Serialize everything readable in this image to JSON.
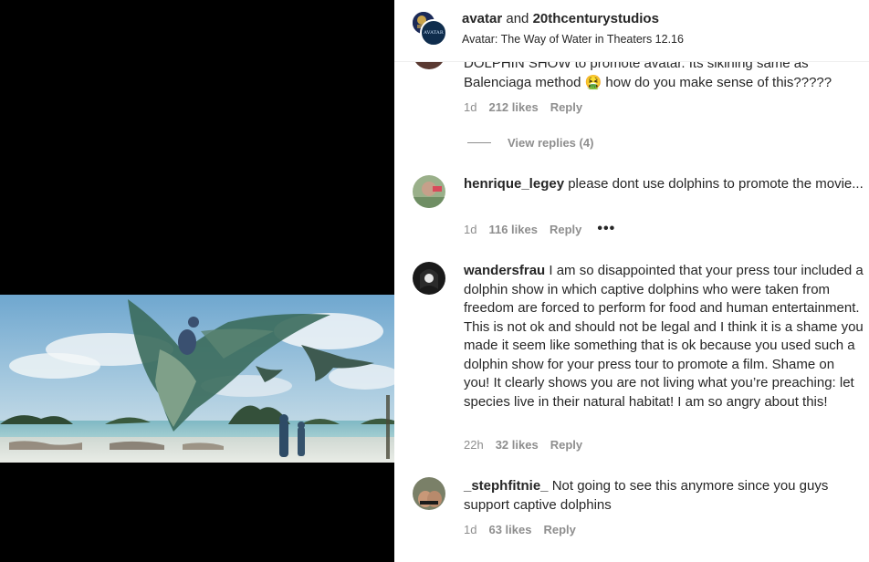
{
  "post": {
    "header": {
      "user1": "avatar",
      "joiner": " and ",
      "user2": "20thcenturystudios",
      "subtitle": "Avatar: The Way of Water in Theaters 12.16",
      "avatar_logo_text": "AVATAR"
    }
  },
  "comments": [
    {
      "partial": true,
      "text_line1": "DOLPHIN SHOW to promote avatar. Its sikining same as",
      "text_line2": "Balenciaga method 🤮  how do you make sense of this?????",
      "time": "1d",
      "likes": "212 likes",
      "reply": "Reply",
      "view_replies": "View replies (4)"
    },
    {
      "user": "henrique_legey",
      "text": "please dont use dolphins to promote the movie...",
      "time": "1d",
      "likes": "116 likes",
      "reply": "Reply",
      "more": "•••"
    },
    {
      "user": "wandersfrau",
      "text": "I am so disappointed that your press tour included a dolphin show in which captive dolphins who were taken from freedom are forced to perform for food and human entertainment. This is not ok and should not be legal and I think it is a shame you made it seem like something that is ok because you used such a dolphin show for your press tour to promote a film. Shame on you! It clearly shows you are not living what you’re preaching: let species live in their natural habitat! I am so angry about this!",
      "time": "22h",
      "likes": "32 likes",
      "reply": "Reply"
    },
    {
      "user": "_stephfitnie_",
      "text": "Not going to see this anymore since you guys support captive dolphins",
      "time": "1d",
      "likes": "63 likes",
      "reply": "Reply"
    }
  ],
  "colors": {
    "text": "#262626",
    "secondary": "#8e8e8e",
    "divider": "#efefef",
    "background": "#ffffff",
    "media_bg": "#000000"
  }
}
